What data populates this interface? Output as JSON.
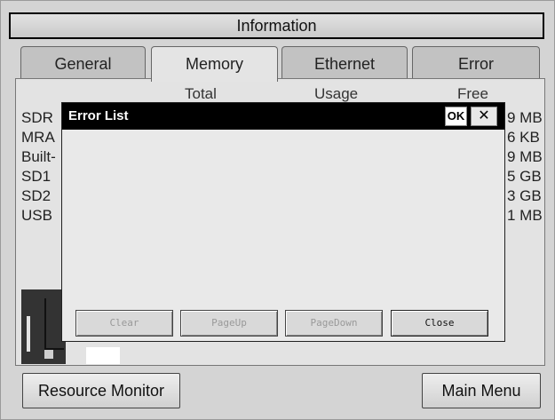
{
  "window": {
    "title": "Information"
  },
  "tabs": [
    {
      "label": "General",
      "active": false
    },
    {
      "label": "Memory",
      "active": true
    },
    {
      "label": "Ethernet",
      "active": false
    },
    {
      "label": "Error",
      "active": false
    }
  ],
  "memory_table": {
    "headers": {
      "total": "Total",
      "usage": "Usage",
      "free": "Free"
    },
    "rows": [
      {
        "label": "SDR",
        "free": "9 MB"
      },
      {
        "label": "MRA",
        "free": "6 KB"
      },
      {
        "label": "Built-",
        "free": "9 MB"
      },
      {
        "label": "SD1",
        "free": "5 GB"
      },
      {
        "label": "SD2",
        "free": "3 GB"
      },
      {
        "label": "USB",
        "free": "1 MB"
      }
    ]
  },
  "dialog": {
    "title": "Error List",
    "ok_label": "OK",
    "close_glyph": "✕",
    "buttons": {
      "clear": "Clear",
      "page_up": "PageUp",
      "page_down": "PageDown",
      "close": "Close"
    }
  },
  "bottom": {
    "resource_monitor": "Resource Monitor",
    "main_menu": "Main Menu"
  }
}
